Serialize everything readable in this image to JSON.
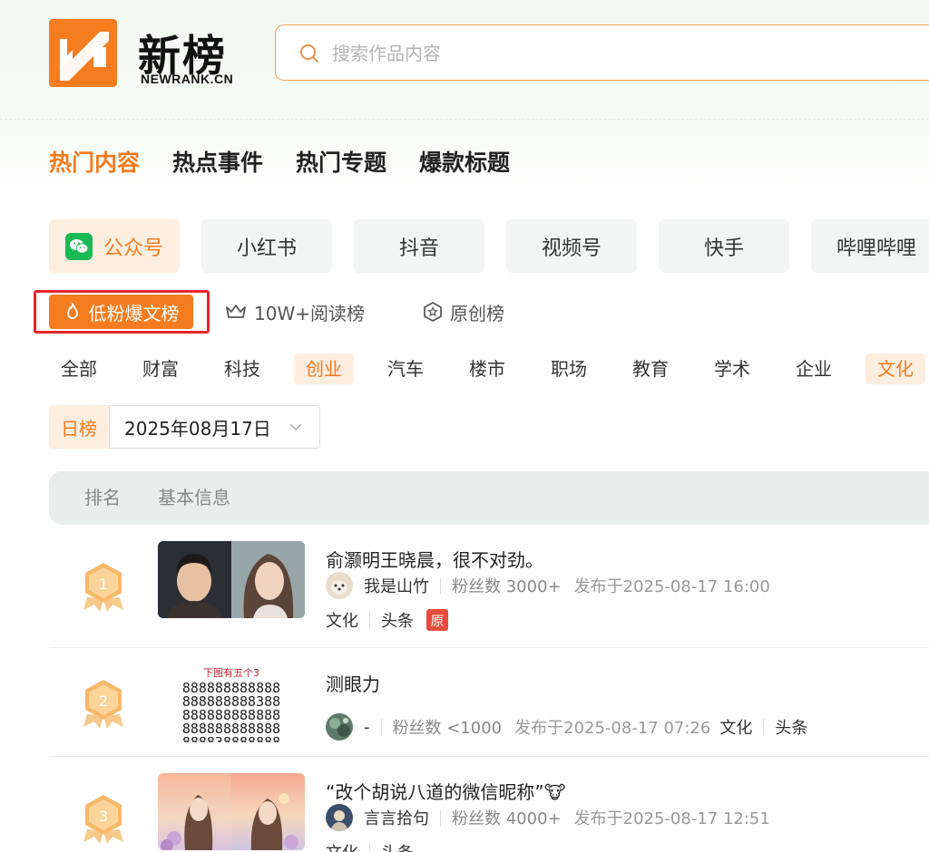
{
  "logo": {
    "word": "新榜",
    "sub": "NEWRANK.CN"
  },
  "search": {
    "placeholder": "搜索作品内容"
  },
  "main_nav": [
    "热门内容",
    "热点事件",
    "热门专题",
    "爆款标题"
  ],
  "platforms": [
    "公众号",
    "小红书",
    "抖音",
    "视频号",
    "快手",
    "哔哩哔哩"
  ],
  "sub_tabs": [
    "低粉爆文榜",
    "10W+阅读榜",
    "原创榜"
  ],
  "categories": [
    "全部",
    "财富",
    "科技",
    "创业",
    "汽车",
    "楼市",
    "职场",
    "教育",
    "学术",
    "企业",
    "文化"
  ],
  "date": {
    "label": "日榜",
    "value": "2025年08月17日"
  },
  "table_header": {
    "rank": "排名",
    "info": "基本信息"
  },
  "rows": [
    {
      "rank": "1",
      "title": "俞灏明王晓晨，很不对劲。",
      "author": "我是山竹",
      "fans": "粉丝数 3000+",
      "published": "发布于2025-08-17 16:00",
      "tags": [
        "文化",
        "头条"
      ],
      "original_badge": "原"
    },
    {
      "rank": "2",
      "title": "测眼力",
      "author": "-",
      "fans": "粉丝数 <1000",
      "published": "发布于2025-08-17 07:26",
      "tags": [
        "文化",
        "头条"
      ],
      "thumb_caption": "下图有五个3",
      "thumb_lines": [
        "888888888888",
        "888888888388",
        "888888888888",
        "888888888888",
        "888838888888"
      ]
    },
    {
      "rank": "3",
      "title": "“改个胡说八道的微信昵称”🐮",
      "author": "言言拾句",
      "fans": "粉丝数 4000+",
      "published": "发布于2025-08-17 12:51",
      "tags": [
        "文化",
        "头条"
      ]
    }
  ]
}
